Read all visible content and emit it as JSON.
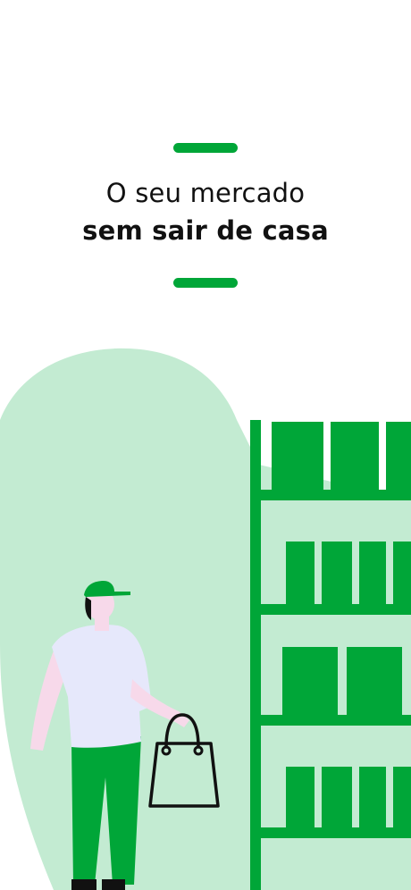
{
  "onboarding": {
    "headline_line1": "O seu mercado",
    "headline_line2": "sem sair de casa"
  },
  "illustration": {
    "subject": "delivery-person-with-shopping-bag-at-supermarket-shelf"
  },
  "colors": {
    "brand_green": "#00a638",
    "light_green": "#c3ebd2",
    "shirt": "#e6e8fb",
    "skin": "#f7d9ea",
    "outline": "#111111",
    "background": "#ffffff"
  }
}
